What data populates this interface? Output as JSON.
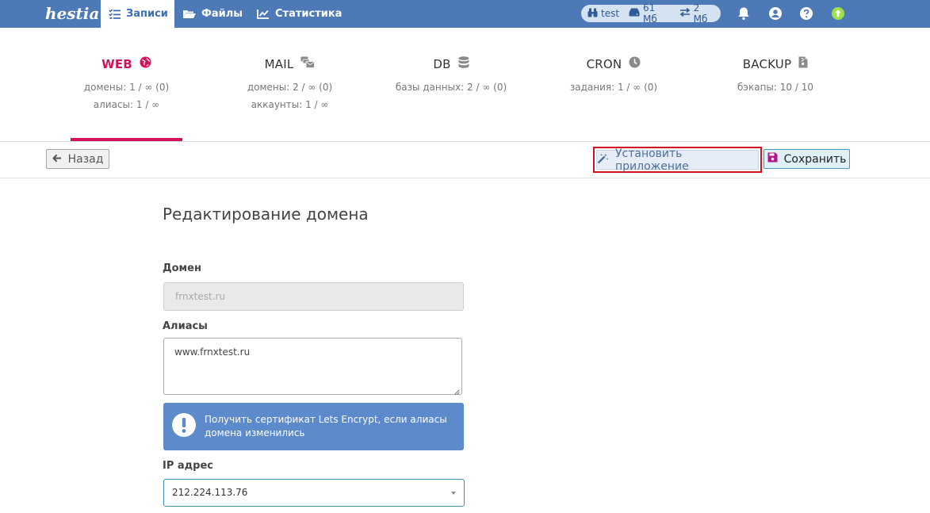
{
  "brand": {
    "logo_text": "hestia"
  },
  "nav": {
    "items": [
      {
        "label": "Записи",
        "icon": "list-check-icon"
      },
      {
        "label": "Файлы",
        "icon": "folder-open-icon"
      },
      {
        "label": "Статистика",
        "icon": "chart-line-icon"
      }
    ]
  },
  "userbar": {
    "username": "test",
    "disk": "61 Мб",
    "bandwidth": "2 Мб"
  },
  "tabs": [
    {
      "title": "WEB",
      "icon": "globe-icon",
      "stat1": "домены: 1 / ∞ (0)",
      "stat2": "алиасы: 1 / ∞"
    },
    {
      "title": "MAIL",
      "icon": "mail-bulk-icon",
      "stat1": "домены: 2 / ∞ (0)",
      "stat2": "аккаунты: 1 / ∞"
    },
    {
      "title": "DB",
      "icon": "database-icon",
      "stat1": "базы данных: 2 / ∞ (0)",
      "stat2": ""
    },
    {
      "title": "CRON",
      "icon": "clock-icon",
      "stat1": "задания: 1 / ∞ (0)",
      "stat2": ""
    },
    {
      "title": "BACKUP",
      "icon": "file-archive-icon",
      "stat1": "бэкапы: 10 / 10",
      "stat2": ""
    }
  ],
  "toolbar": {
    "back_label": "Назад",
    "install_label": "Установить приложение",
    "save_label": "Сохранить"
  },
  "form": {
    "title": "Редактирование домена",
    "domain_label": "Домен",
    "domain_value": "frnxtest.ru",
    "aliases_label": "Алиасы",
    "aliases_value": "www.frnxtest.ru",
    "notice_text": "Получить сертификат Lets Encrypt, если алиасы домена изменились",
    "ip_label": "IP адрес",
    "ip_value": "212.224.113.76"
  },
  "colors": {
    "topbar": "#4d7ab7",
    "accent": "#d4115a",
    "notice": "#5d8acb",
    "highlight": "#d1121f"
  }
}
